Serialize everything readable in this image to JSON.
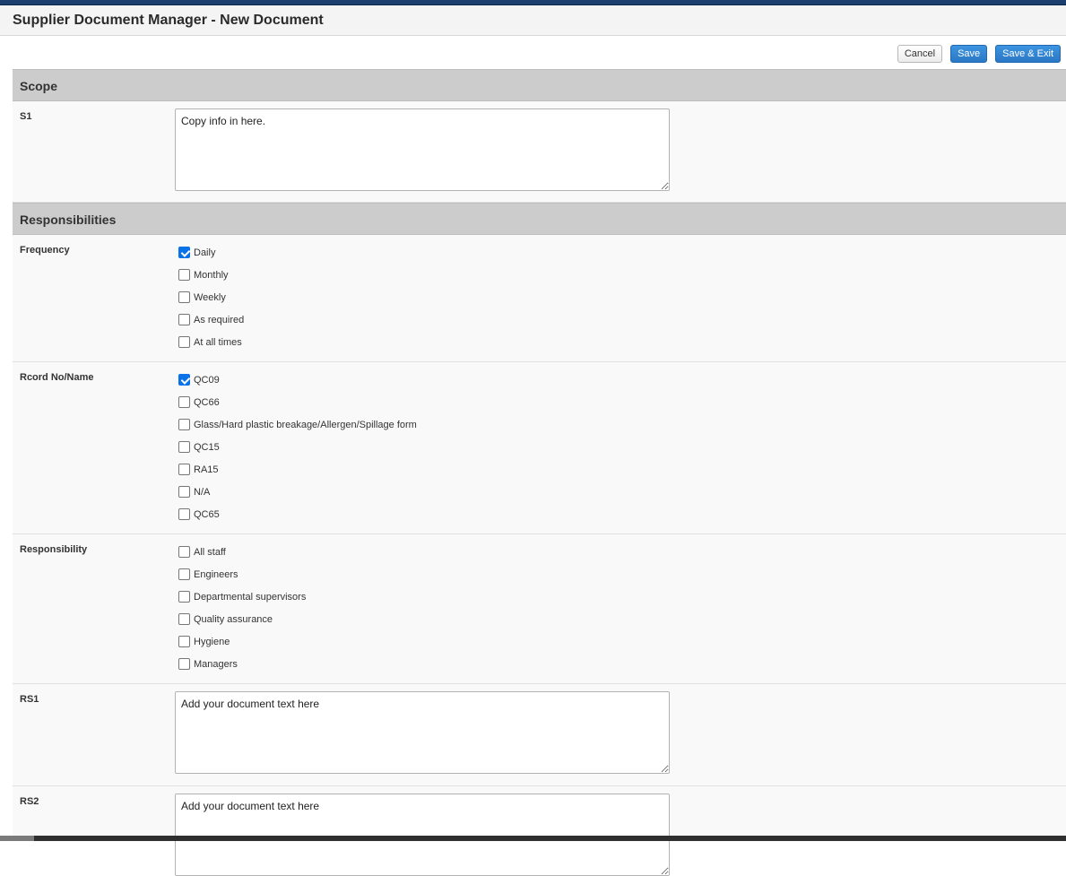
{
  "header": {
    "title": "Supplier Document Manager - New Document"
  },
  "toolbar": {
    "cancel_label": "Cancel",
    "save_label": "Save",
    "save_exit_label": "Save & Exit"
  },
  "sections": {
    "scope": {
      "title": "Scope",
      "s1": {
        "label": "S1",
        "value": "Copy info in here."
      }
    },
    "responsibilities": {
      "title": "Responsibilities",
      "frequency": {
        "label": "Frequency",
        "options": [
          {
            "label": "Daily",
            "checked": true
          },
          {
            "label": "Monthly",
            "checked": false
          },
          {
            "label": "Weekly",
            "checked": false
          },
          {
            "label": "As required",
            "checked": false
          },
          {
            "label": "At all times",
            "checked": false
          }
        ]
      },
      "record": {
        "label": "Rcord No/Name",
        "options": [
          {
            "label": "QC09",
            "checked": true
          },
          {
            "label": "QC66",
            "checked": false
          },
          {
            "label": "Glass/Hard plastic breakage/Allergen/Spillage form",
            "checked": false
          },
          {
            "label": "QC15",
            "checked": false
          },
          {
            "label": "RA15",
            "checked": false
          },
          {
            "label": "N/A",
            "checked": false
          },
          {
            "label": "QC65",
            "checked": false
          }
        ]
      },
      "responsibility": {
        "label": "Responsibility",
        "options": [
          {
            "label": "All staff",
            "checked": false
          },
          {
            "label": "Engineers",
            "checked": false
          },
          {
            "label": "Departmental supervisors",
            "checked": false
          },
          {
            "label": "Quality assurance",
            "checked": false
          },
          {
            "label": "Hygiene",
            "checked": false
          },
          {
            "label": "Managers",
            "checked": false
          }
        ]
      },
      "rs1": {
        "label": "RS1",
        "value": "Add your document text here"
      },
      "rs2": {
        "label": "RS2",
        "value": "Add your document text here"
      }
    }
  }
}
